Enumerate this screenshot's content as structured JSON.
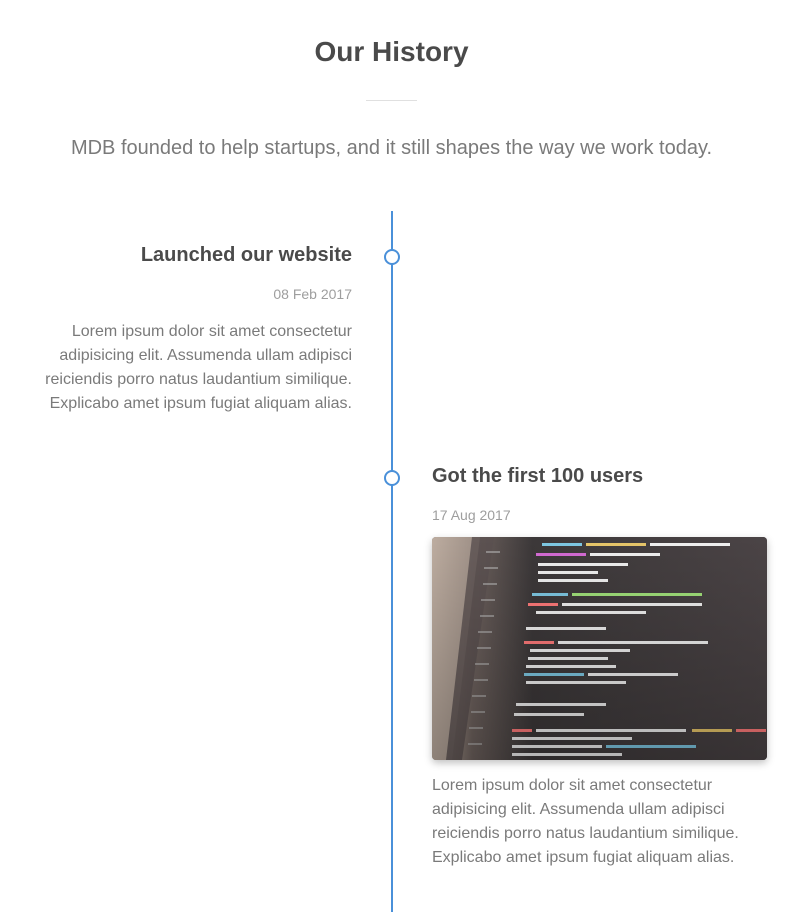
{
  "header": {
    "title": "Our History",
    "subtitle": "MDB founded to help startups, and it still shapes the way we work today."
  },
  "colors": {
    "timeline": "#4a90d9",
    "title": "#4a4a4a",
    "text": "#7a7a7a",
    "date": "#9e9e9e"
  },
  "events": [
    {
      "title": "Launched our website",
      "date": "08 Feb 2017",
      "text": "Lorem ipsum dolor sit amet consectetur adipisicing elit. Assumenda ullam adipisci reiciendis porro natus laudantium similique. Explicabo amet ipsum fugiat aliquam alias."
    },
    {
      "title": "Got the first 100 users",
      "date": "17 Aug 2017",
      "image": "code-on-laptop-screen",
      "text": "Lorem ipsum dolor sit amet consectetur adipisicing elit. Assumenda ullam adipisci reiciendis porro natus laudantium similique. Explicabo amet ipsum fugiat aliquam alias."
    }
  ]
}
